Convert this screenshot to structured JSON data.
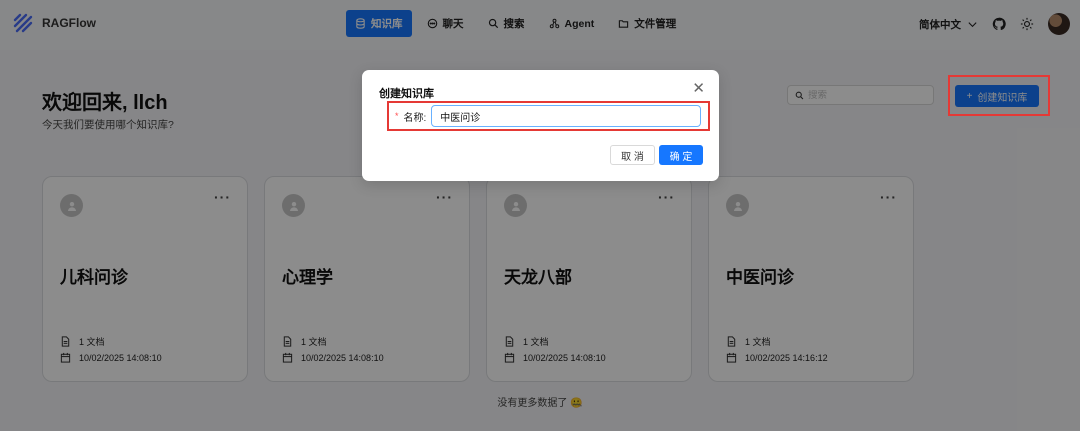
{
  "app": {
    "name": "RAGFlow"
  },
  "nav": [
    {
      "label": "知识库",
      "icon": "database-icon",
      "active": true
    },
    {
      "label": "聊天",
      "icon": "chat-icon",
      "active": false
    },
    {
      "label": "搜索",
      "icon": "search-icon",
      "active": false
    },
    {
      "label": "Agent",
      "icon": "agent-icon",
      "active": false
    },
    {
      "label": "文件管理",
      "icon": "folder-icon",
      "active": false
    }
  ],
  "header_right": {
    "language": "简体中文"
  },
  "main": {
    "welcome_title": "欢迎回来, llch",
    "welcome_subtitle": "今天我们要使用哪个知识库?",
    "search_placeholder": "搜索",
    "create_button": "创建知识库",
    "footer_note": "没有更多数据了 🤐"
  },
  "cards": [
    {
      "title": "儿科问诊",
      "docs": "1 文档",
      "date": "10/02/2025 14:08:10"
    },
    {
      "title": "心理学",
      "docs": "1 文档",
      "date": "10/02/2025 14:08:10"
    },
    {
      "title": "天龙八部",
      "docs": "1 文档",
      "date": "10/02/2025 14:08:10"
    },
    {
      "title": "中医问诊",
      "docs": "1 文档",
      "date": "10/02/2025 14:16:12"
    }
  ],
  "modal": {
    "title": "创建知识库",
    "required_mark": "*",
    "name_label": "名称:",
    "name_value": "中医问诊",
    "cancel": "取 消",
    "ok": "确 定"
  },
  "colors": {
    "primary": "#1677ff",
    "highlight": "#e53935"
  }
}
